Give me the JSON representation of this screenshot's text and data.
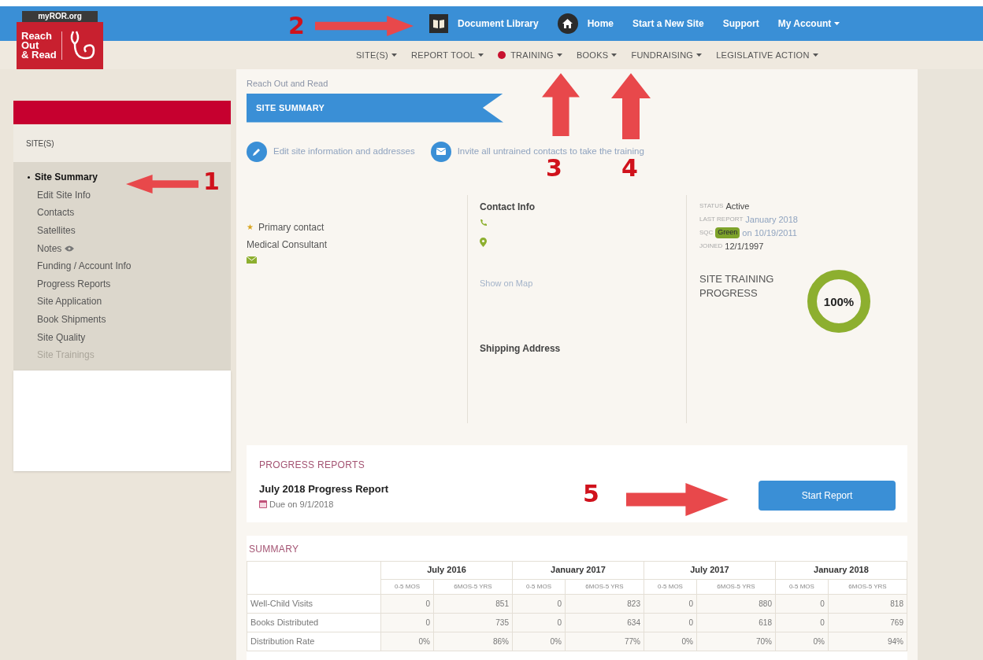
{
  "logo": {
    "site": "myROR.org",
    "lines": [
      "Reach",
      "Out",
      "& Read"
    ]
  },
  "top_nav": [
    {
      "label": "Document Library"
    },
    {
      "label": "Home"
    },
    {
      "label": "Start a New Site"
    },
    {
      "label": "Support"
    },
    {
      "label": "My Account",
      "dropdown": true
    }
  ],
  "main_nav": [
    {
      "label": "SITE(S)",
      "alert": false
    },
    {
      "label": "REPORT TOOL",
      "alert": false
    },
    {
      "label": "TRAINING",
      "alert": true
    },
    {
      "label": "BOOKS",
      "alert": false
    },
    {
      "label": "FUNDRAISING",
      "alert": false
    },
    {
      "label": "LEGISLATIVE ACTION",
      "alert": false
    }
  ],
  "sidebar": {
    "title": "SITE(S)",
    "items": [
      {
        "label": "Site Summary",
        "selected": true,
        "disabled": false
      },
      {
        "label": "Edit Site Info",
        "selected": false,
        "disabled": false
      },
      {
        "label": "Contacts",
        "selected": false,
        "disabled": false
      },
      {
        "label": "Satellites",
        "selected": false,
        "disabled": false
      },
      {
        "label": "Notes",
        "selected": false,
        "disabled": false
      },
      {
        "label": "Funding / Account Info",
        "selected": false,
        "disabled": false
      },
      {
        "label": "Progress Reports",
        "selected": false,
        "disabled": false
      },
      {
        "label": "Site Application",
        "selected": false,
        "disabled": false
      },
      {
        "label": "Book Shipments",
        "selected": false,
        "disabled": false
      },
      {
        "label": "Site Quality",
        "selected": false,
        "disabled": false
      },
      {
        "label": "Site Trainings",
        "selected": false,
        "disabled": true
      }
    ]
  },
  "breadcrumb": "Reach Out and Read",
  "banner": "SITE SUMMARY",
  "actions": [
    {
      "label": "Edit site information and addresses"
    },
    {
      "label": "Invite all untrained contacts to take the training"
    }
  ],
  "contact": {
    "star": "★",
    "role": "Primary contact",
    "title": "Medical Consultant"
  },
  "contact_info": {
    "heading": "Contact Info",
    "map_link": "Show on Map",
    "shipping_heading": "Shipping Address"
  },
  "status": [
    {
      "label": "STATUS",
      "value": "Active",
      "kind": "plain"
    },
    {
      "label": "LAST REPORT",
      "value": "January 2018",
      "kind": "link"
    },
    {
      "label": "SQC",
      "badge": "Green",
      "value": "on 10/19/2011",
      "kind": "badge"
    },
    {
      "label": "JOINED",
      "value": "12/1/1997",
      "kind": "plain"
    }
  ],
  "training_progress": {
    "title": "SITE TRAINING PROGRESS",
    "reading": "100%"
  },
  "progress_reports": {
    "title": "PROGRESS REPORTS",
    "report": "July 2018 Progress Report",
    "due": "Due on 9/1/2018",
    "button": "Start Report"
  },
  "summary": {
    "title": "SUMMARY",
    "periods": [
      {
        "label": "July 2016",
        "subcolumns": [
          "0-5 MOS",
          "6MOS-5 YRS"
        ]
      },
      {
        "label": "January 2017",
        "subcolumns": [
          "0-5 MOS",
          "6MOS-5 YRS"
        ]
      },
      {
        "label": "July 2017",
        "subcolumns": [
          "0-5 MOS",
          "6MOS-5 YRS"
        ]
      },
      {
        "label": "January 2018",
        "subcolumns": [
          "0-5 MOS",
          "6MOS-5 YRS"
        ]
      }
    ],
    "rows": [
      {
        "label": "Well-Child Visits",
        "cells": [
          "0",
          "851",
          "0",
          "823",
          "0",
          "880",
          "0",
          "818"
        ]
      },
      {
        "label": "Books Distributed",
        "cells": [
          "0",
          "735",
          "0",
          "634",
          "0",
          "618",
          "0",
          "769"
        ]
      },
      {
        "label": "Distribution Rate",
        "cells": [
          "0%",
          "86%",
          "0%",
          "77%",
          "0%",
          "70%",
          "0%",
          "94%"
        ]
      }
    ]
  },
  "annotations": [
    {
      "label": "1"
    },
    {
      "label": "2"
    },
    {
      "label": "3"
    },
    {
      "label": "4"
    },
    {
      "label": "5"
    }
  ]
}
